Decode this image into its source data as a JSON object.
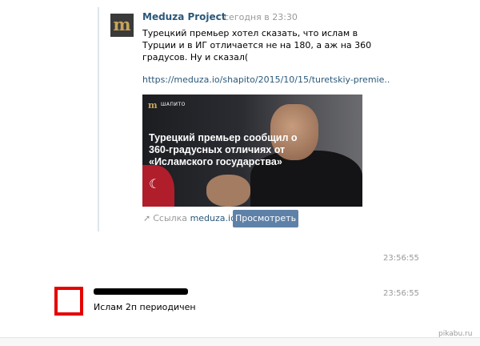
{
  "post": {
    "author": "Meduza Project",
    "time": "сегодня в 23:30",
    "logo_letter": "m",
    "text": "Турецкий премьер хотел сказать, что ислам в Турции и в ИГ отличается не на 180, а аж на 360 градусов. Ну и сказал(",
    "link": "https://meduza.io/shapito/2015/10/15/turetskiy-premie..",
    "preview": {
      "badge_letter": "m",
      "badge": "ШАПИТО",
      "headline": "Турецкий премьер сообщил о 360-градусных отличиях от «Исламского государства»"
    },
    "share": {
      "icon": "share-arrow-icon",
      "label": "Ссылка",
      "domain": "meduza.io",
      "button": "Просмотреть"
    }
  },
  "messages": [
    {
      "time": "23:56:55"
    },
    {
      "time": "23:56:55",
      "text": "Ислам 2п периодичен"
    }
  ],
  "watermark": "pikabu.ru",
  "colors": {
    "link": "#2b587a",
    "button": "#5e81a8",
    "muted": "#999999",
    "highlight": "#e60000"
  }
}
